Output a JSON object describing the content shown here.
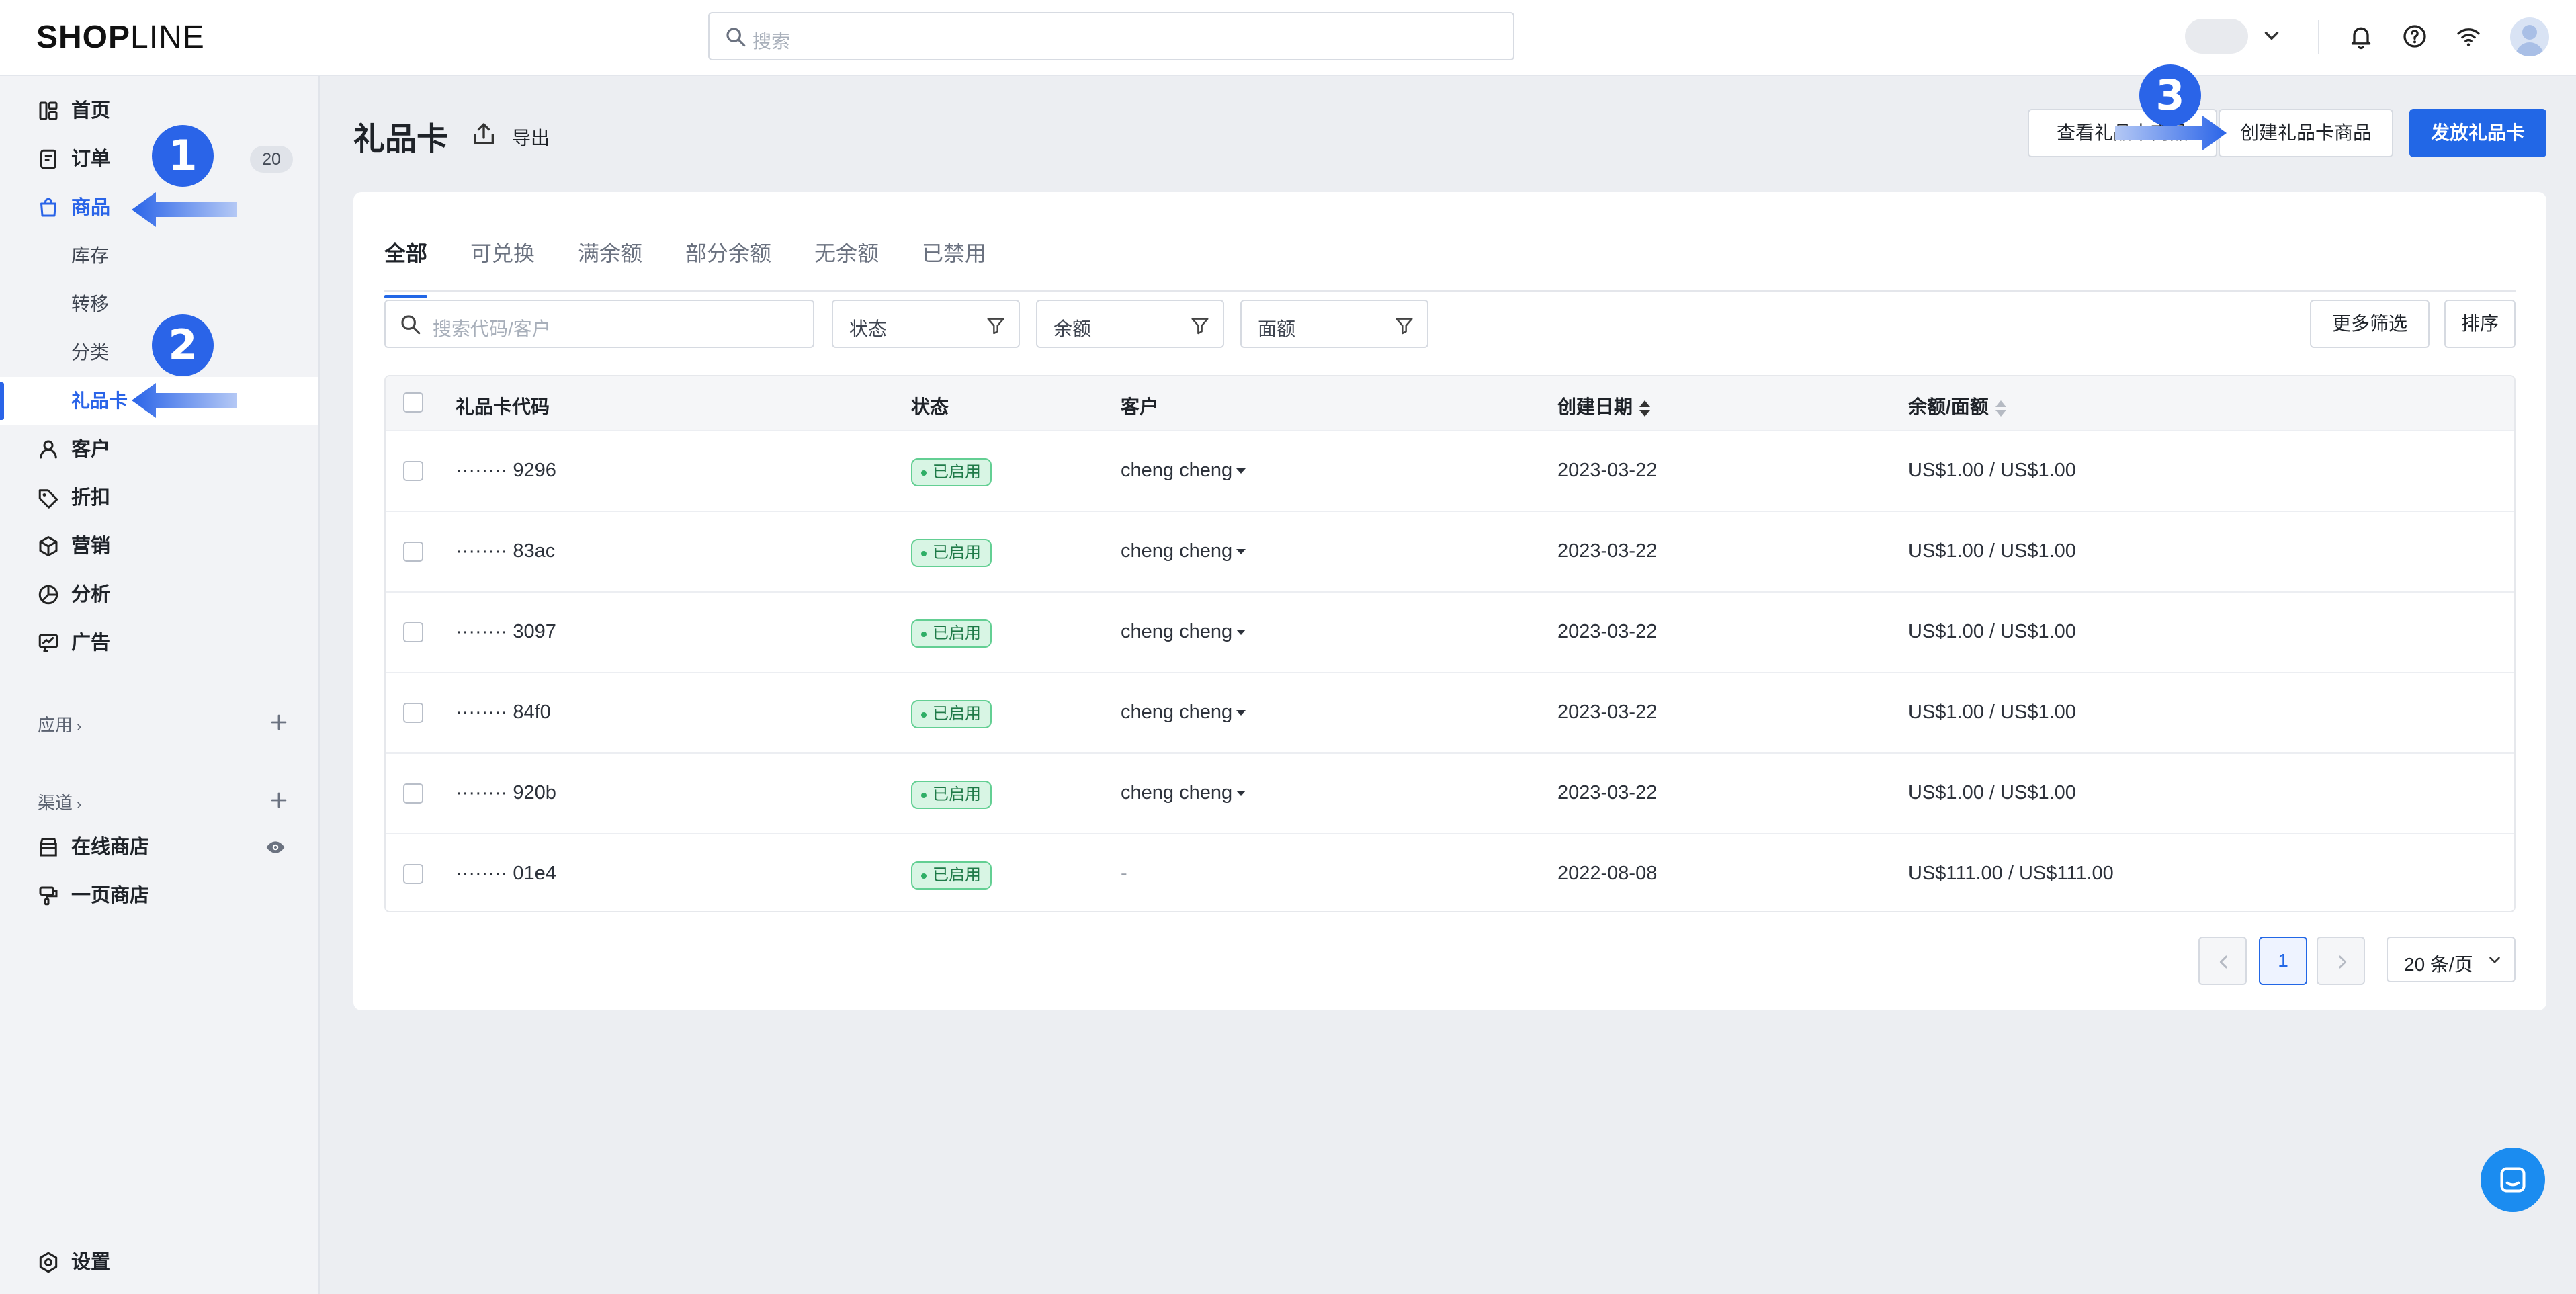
{
  "header": {
    "logo_part1": "SHOP",
    "logo_part2": "LINE",
    "search_placeholder": "搜索"
  },
  "sidebar": {
    "items": [
      {
        "label": "首页",
        "icon": "home-icon"
      },
      {
        "label": "订单",
        "icon": "order-icon",
        "badge": "20"
      },
      {
        "label": "商品",
        "icon": "shopping-bag-icon",
        "active": true
      },
      {
        "label": "客户",
        "icon": "user-icon"
      },
      {
        "label": "折扣",
        "icon": "tag-icon"
      },
      {
        "label": "营销",
        "icon": "cube-icon"
      },
      {
        "label": "分析",
        "icon": "pie-chart-icon"
      },
      {
        "label": "广告",
        "icon": "ads-icon"
      }
    ],
    "sub_items": [
      {
        "label": "库存"
      },
      {
        "label": "转移"
      },
      {
        "label": "分类"
      },
      {
        "label": "礼品卡",
        "active": true
      }
    ],
    "apps_label": "应用",
    "channels_label": "渠道",
    "channels": [
      {
        "label": "在线商店",
        "icon": "store-icon"
      },
      {
        "label": "一页商店",
        "icon": "one-page-store-icon"
      }
    ],
    "settings_label": "设置"
  },
  "annotations": [
    "1",
    "2",
    "3"
  ],
  "page": {
    "title": "礼品卡",
    "export_label": "导出",
    "btn_view_products": "查看礼品卡商品",
    "btn_create_product": "创建礼品卡商品",
    "btn_issue": "发放礼品卡"
  },
  "tabs": [
    "全部",
    "可兑换",
    "满余额",
    "部分余额",
    "无余额",
    "已禁用"
  ],
  "filters": {
    "search_placeholder": "搜索代码/客户",
    "status": "状态",
    "balance": "余额",
    "denomination": "面额",
    "more_filters": "更多筛选",
    "sort": "排序"
  },
  "table": {
    "headers": {
      "code": "礼品卡代码",
      "status": "状态",
      "customer": "客户",
      "created": "创建日期",
      "balance": "余额/面额"
    },
    "rows": [
      {
        "code": "········ 9296",
        "status": "已启用",
        "customer": "cheng cheng",
        "created": "2023-03-22",
        "balance": "US$1.00 / US$1.00"
      },
      {
        "code": "········ 83ac",
        "status": "已启用",
        "customer": "cheng cheng",
        "created": "2023-03-22",
        "balance": "US$1.00 / US$1.00"
      },
      {
        "code": "········ 3097",
        "status": "已启用",
        "customer": "cheng cheng",
        "created": "2023-03-22",
        "balance": "US$1.00 / US$1.00"
      },
      {
        "code": "········ 84f0",
        "status": "已启用",
        "customer": "cheng cheng",
        "created": "2023-03-22",
        "balance": "US$1.00 / US$1.00"
      },
      {
        "code": "········ 920b",
        "status": "已启用",
        "customer": "cheng cheng",
        "created": "2023-03-22",
        "balance": "US$1.00 / US$1.00"
      },
      {
        "code": "········ 01e4",
        "status": "已启用",
        "customer": "-",
        "created": "2022-08-08",
        "balance": "US$111.00 / US$111.00"
      }
    ]
  },
  "pagination": {
    "current_page": "1",
    "page_size": "20 条/页"
  },
  "colors": {
    "accent": "#2267e6",
    "status_green": "#2fae66",
    "annotation": "#2a64e8"
  }
}
